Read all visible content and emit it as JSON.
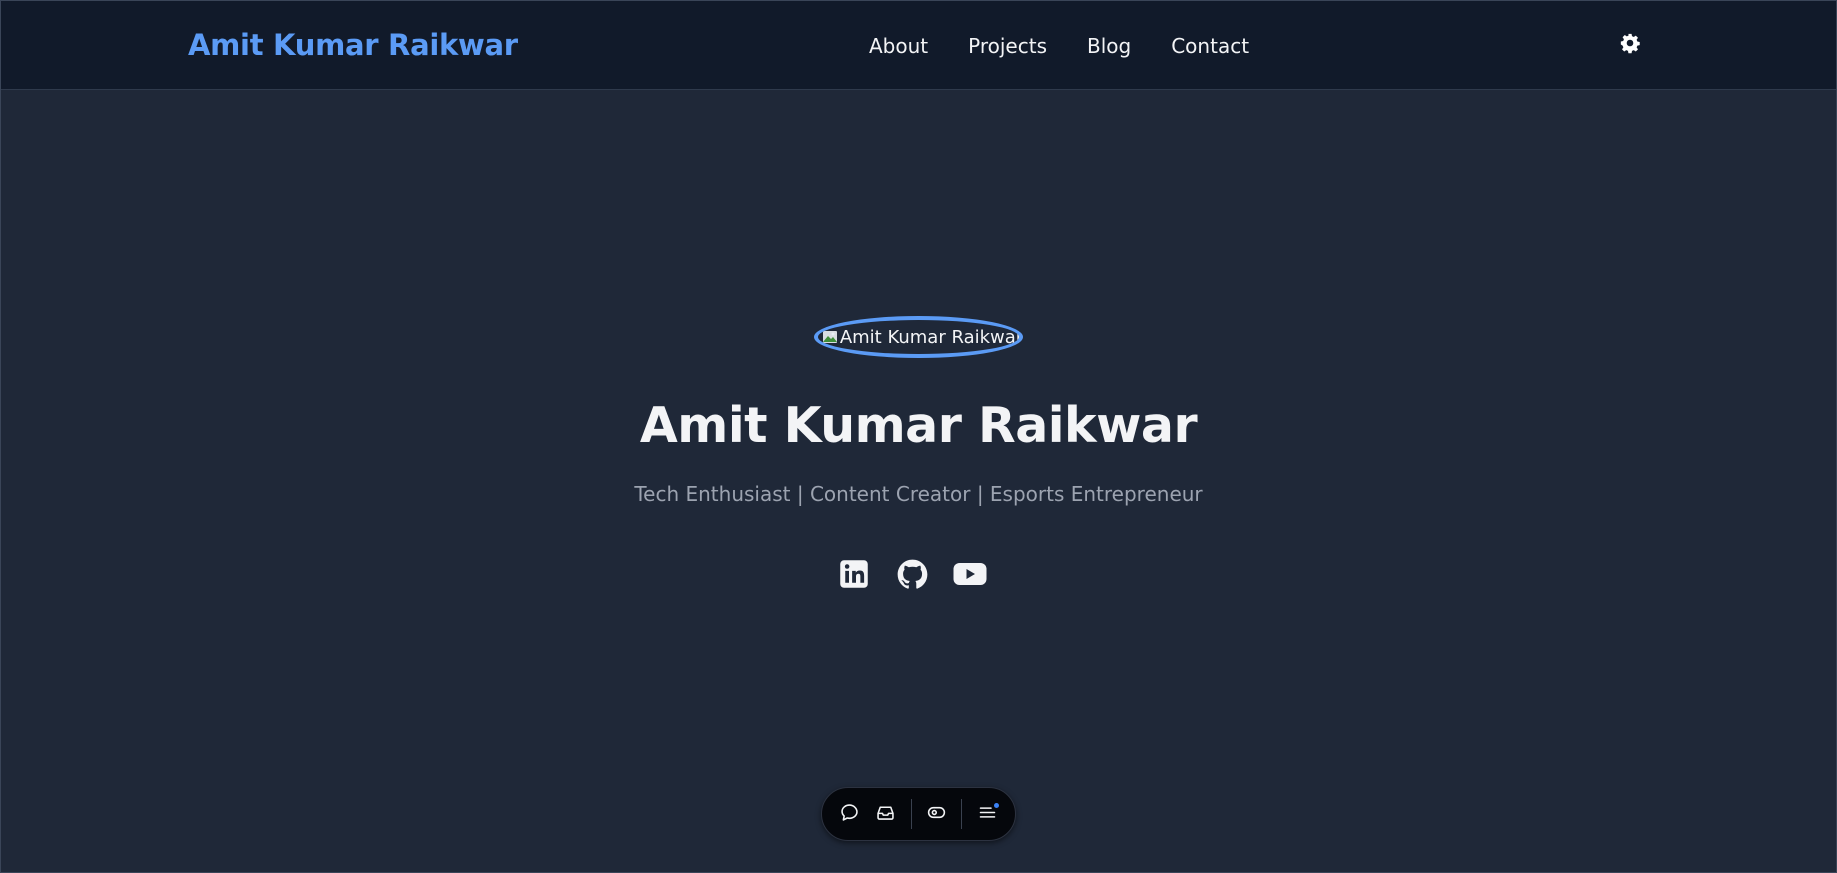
{
  "header": {
    "brand": "Amit Kumar Raikwar",
    "nav": [
      "About",
      "Projects",
      "Blog",
      "Contact"
    ],
    "theme_toggle_icon": "gear-icon"
  },
  "hero": {
    "avatar_alt": "Amit Kumar Raikwar",
    "title": "Amit Kumar Raikwar",
    "subtitle": "Tech Enthusiast | Content Creator | Esports Entrepreneur",
    "socials": [
      "linkedin-icon",
      "github-icon",
      "youtube-icon"
    ]
  },
  "toolbar": {
    "icons": [
      "chat-icon",
      "inbox-icon",
      "eye-icon",
      "menu-icon"
    ]
  },
  "colors": {
    "accent": "#5b9bf5",
    "header_bg": "#111a2a",
    "page_bg": "#1f2838",
    "text": "#f3f4f6",
    "muted_text": "#9ca3b0",
    "notification_dot": "#3b82f6"
  }
}
